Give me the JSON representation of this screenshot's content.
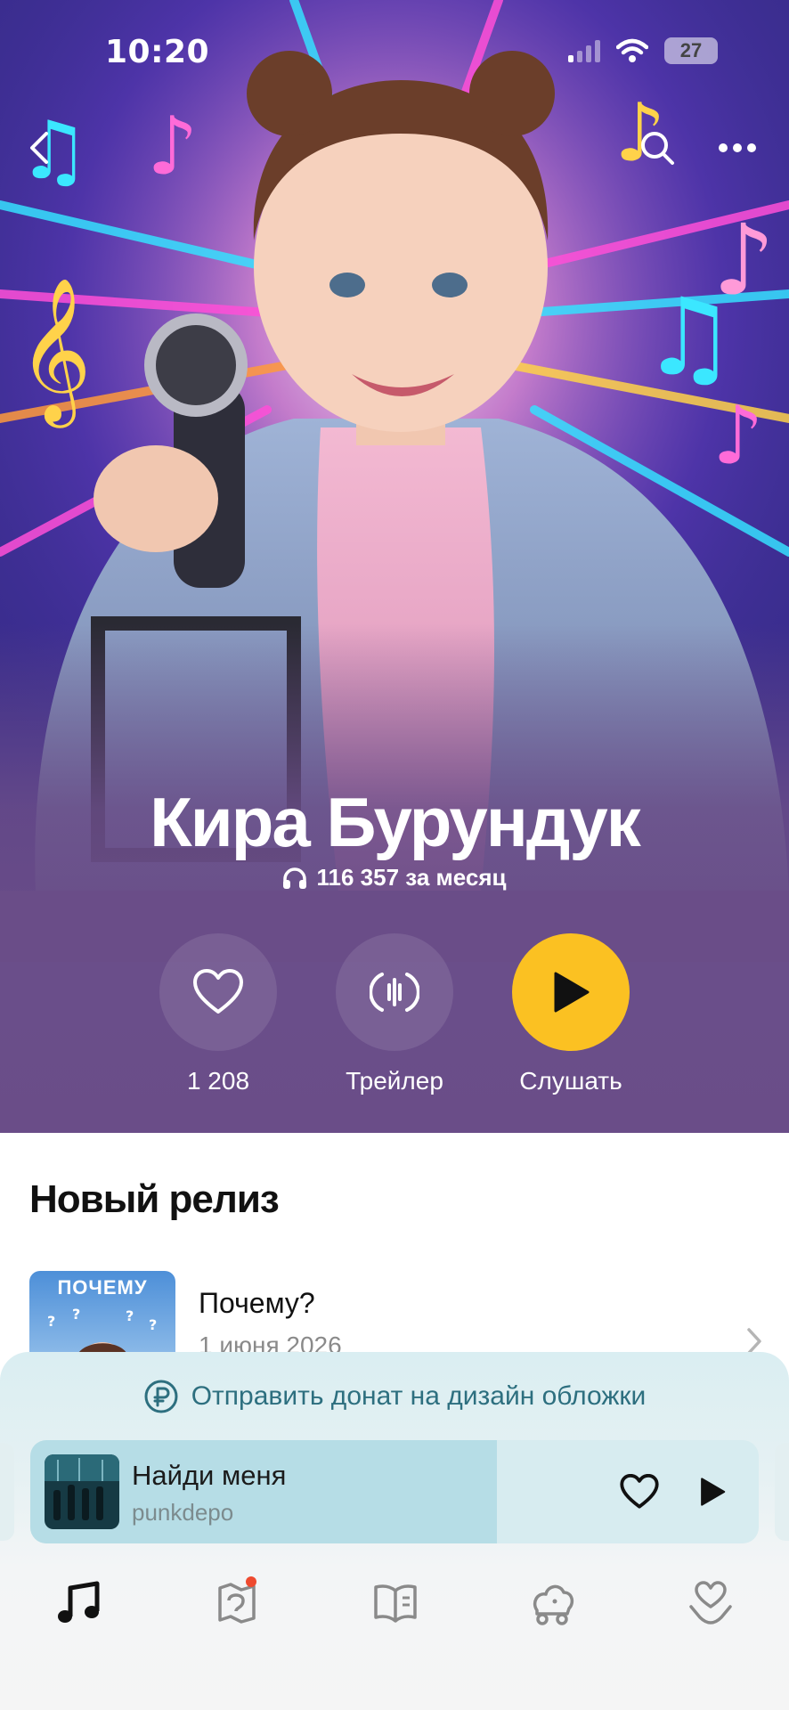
{
  "status_bar": {
    "time": "10:20",
    "battery": "27"
  },
  "artist": {
    "name": "Кира Бурундук",
    "listeners": "116 357 за месяц"
  },
  "actions": [
    {
      "label": "1 208",
      "icon": "heart-icon"
    },
    {
      "label": "Трейлер",
      "icon": "trailer-wave-icon"
    },
    {
      "label": "Слушать",
      "icon": "play-icon"
    }
  ],
  "new_release": {
    "section_title": "Новый релиз",
    "title": "Почему?",
    "date": "1 июня 2026",
    "cover_text": "ПОЧЕМУ"
  },
  "donate": {
    "label": "Отправить донат на дизайн обложки",
    "icon": "ruble-icon"
  },
  "player": {
    "title": "Найди меня",
    "artist": "punkdepo",
    "progress": 0.64
  },
  "tabs": [
    {
      "icon": "music-note-icon",
      "active": true
    },
    {
      "icon": "map-icon",
      "badge": true
    },
    {
      "icon": "book-icon"
    },
    {
      "icon": "kids-toy-icon"
    },
    {
      "icon": "heart-hand-icon"
    }
  ],
  "colors": {
    "accent_yellow": "#fbc122",
    "hero_purple": "#6a4d88",
    "donate_teal": "#2d6f7f",
    "badge_red": "#ee4a2f"
  }
}
